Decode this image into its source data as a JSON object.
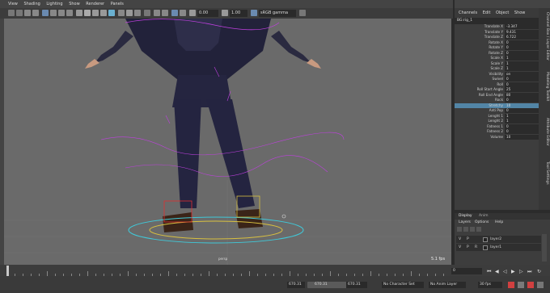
{
  "viewport_menu": [
    "View",
    "Shading",
    "Lighting",
    "Show",
    "Renderer",
    "Panels"
  ],
  "toolbar": {
    "exposure": "0.00",
    "gamma": "1.00",
    "colorspace": "sRGB gamma"
  },
  "viewport": {
    "camera_label": "persp",
    "fps": "5.1 fps"
  },
  "channel_box": {
    "menus": [
      "Channels",
      "Edit",
      "Object",
      "Show"
    ],
    "object_name": "BG:rig_1",
    "selected_attr": "Stretchy",
    "attributes": [
      {
        "label": "Translate X",
        "value": "-3.347"
      },
      {
        "label": "Translate Y",
        "value": "9.431"
      },
      {
        "label": "Translate Z",
        "value": "6.722"
      },
      {
        "label": "Rotate X",
        "value": "0"
      },
      {
        "label": "Rotate Y",
        "value": "0"
      },
      {
        "label": "Rotate Z",
        "value": "0"
      },
      {
        "label": "Scale X",
        "value": "1"
      },
      {
        "label": "Scale Y",
        "value": "1"
      },
      {
        "label": "Scale Z",
        "value": "1"
      },
      {
        "label": "Visibility",
        "value": "on"
      },
      {
        "label": "Swivel",
        "value": "0"
      },
      {
        "label": "Roll",
        "value": "0"
      },
      {
        "label": "Roll Start Angle",
        "value": "25"
      },
      {
        "label": "Roll End Angle",
        "value": "80"
      },
      {
        "label": "Rock",
        "value": "0"
      },
      {
        "label": "Stretchy",
        "value": "10"
      },
      {
        "label": "Anti Pop",
        "value": "0"
      },
      {
        "label": "Lenght 1",
        "value": "1"
      },
      {
        "label": "Lenght 2",
        "value": "1"
      },
      {
        "label": "Fatness 1",
        "value": "0"
      },
      {
        "label": "Fatness 2",
        "value": "0"
      },
      {
        "label": "Volume",
        "value": "10"
      }
    ]
  },
  "side_tabs": [
    "Channel Box / Layer Editor",
    "Modeling Toolkit",
    "Attribute Editor",
    "Tool Settings"
  ],
  "layer_editor": {
    "tabs": [
      "Display",
      "Anim"
    ],
    "menus": [
      "Layers",
      "Options",
      "Help"
    ],
    "layers": [
      {
        "v": "V",
        "p": "P",
        "r": "",
        "name": "layer2"
      },
      {
        "v": "V",
        "p": "P",
        "r": "R",
        "name": "layer1"
      }
    ]
  },
  "timeline": {
    "current_frame": "0"
  },
  "range": {
    "start": "670.31",
    "range_start": "670.31",
    "range_end": "670.31",
    "character_set": "No Character Set",
    "anim_layer": "No Anim Layer",
    "fps": "30 fps"
  },
  "colors": {
    "viewport_bg": "#6a6a6a",
    "selection": "#5285a6",
    "rig_magenta": "#c040e0",
    "rig_yellow": "#d8c040",
    "rig_cyan": "#40c8d8",
    "rig_red": "#e03030"
  }
}
